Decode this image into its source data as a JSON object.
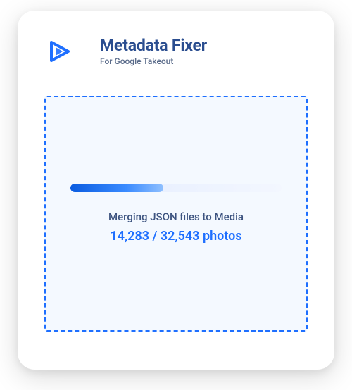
{
  "header": {
    "title": "Metadata Fixer",
    "subtitle": "For Google Takeout"
  },
  "progress": {
    "status_label": "Merging JSON files to Media",
    "count_label": "14,283 / 32,543 photos",
    "percent": 44
  },
  "colors": {
    "accent": "#1e6fff",
    "accent_dark": "#0a5ce0"
  }
}
